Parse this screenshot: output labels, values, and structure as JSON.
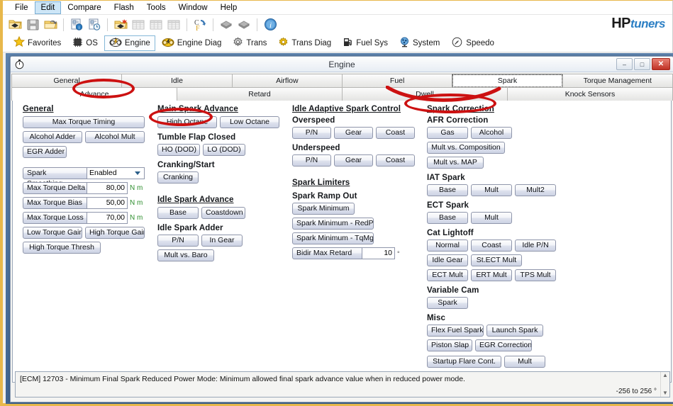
{
  "app": {
    "brand_main": "HP",
    "brand_sub": "tuners"
  },
  "menubar": {
    "items": [
      {
        "label": "File",
        "active": false
      },
      {
        "label": "Edit",
        "active": true
      },
      {
        "label": "Compare",
        "active": false
      },
      {
        "label": "Flash",
        "active": false
      },
      {
        "label": "Tools",
        "active": false
      },
      {
        "label": "Window",
        "active": false
      },
      {
        "label": "Help",
        "active": false
      }
    ]
  },
  "toolbar": {
    "icons": [
      "open-folder-icon",
      "save-disk-icon",
      "open-recent-icon",
      "separator",
      "compare-info-icon",
      "compare-history-icon",
      "separator",
      "open-flash-icon",
      "table-grid-1-icon",
      "table-grid-2-icon",
      "table-grid-3-icon",
      "separator",
      "units-convert-icon",
      "separator",
      "diamond-gray-icon",
      "diamond-gray-2-icon",
      "separator",
      "info-icon"
    ]
  },
  "ribbon": {
    "items": [
      {
        "label": "Favorites",
        "icon": "star-icon",
        "selected": false
      },
      {
        "label": "OS",
        "icon": "chip-icon",
        "selected": false
      },
      {
        "label": "Engine",
        "icon": "engine-icon",
        "selected": true
      },
      {
        "label": "Engine Diag",
        "icon": "engine-diag-icon",
        "selected": false
      },
      {
        "label": "Trans",
        "icon": "gear-icon",
        "selected": false
      },
      {
        "label": "Trans Diag",
        "icon": "gear-diag-icon",
        "selected": false
      },
      {
        "label": "Fuel Sys",
        "icon": "fuel-pump-icon",
        "selected": false
      },
      {
        "label": "System",
        "icon": "system-icon",
        "selected": false
      },
      {
        "label": "Speedo",
        "icon": "speedo-icon",
        "selected": false
      }
    ]
  },
  "window": {
    "title": "Engine",
    "icon": "stopwatch-icon",
    "minimize": "–",
    "maximize": "□",
    "close": "✕"
  },
  "tabs_row1": [
    {
      "label": "General",
      "state": "normal"
    },
    {
      "label": "Idle",
      "state": "normal"
    },
    {
      "label": "Airflow",
      "state": "normal"
    },
    {
      "label": "Fuel",
      "state": "normal"
    },
    {
      "label": "Spark",
      "state": "focus"
    },
    {
      "label": "Torque Management",
      "state": "normal"
    }
  ],
  "tabs_row2": [
    {
      "label": "Advance",
      "state": "selected"
    },
    {
      "label": "Retard",
      "state": "normal"
    },
    {
      "label": "Dwell",
      "state": "normal"
    },
    {
      "label": "Knock Sensors",
      "state": "normal"
    }
  ],
  "col1": {
    "heading": "General",
    "btn_max_torque_timing": "Max Torque Timing",
    "btn_alcohol_adder": "Alcohol Adder",
    "btn_alcohol_mult": "Alcohol Mult",
    "btn_egr_adder": "EGR Adder",
    "spark_smoothing_label": "Spark Smoothing",
    "spark_smoothing_value": "Enabled",
    "max_torque_delta_label": "Max Torque Delta",
    "max_torque_delta_value": "80,00",
    "max_torque_delta_unit": "N m",
    "max_torque_bias_label": "Max Torque Bias",
    "max_torque_bias_value": "50,00",
    "max_torque_bias_unit": "N m",
    "max_torque_loss_label": "Max Torque Loss",
    "max_torque_loss_value": "70,00",
    "max_torque_loss_unit": "N m",
    "btn_low_torque_gain": "Low Torque Gain",
    "btn_high_torque_gain": "High Torque Gain",
    "btn_high_torque_thresh": "High Torque Thresh"
  },
  "col2": {
    "heading": "Main Spark Advance",
    "btn_high_octane": "High Octane",
    "btn_low_octane": "Low Octane",
    "sub_tumble": "Tumble Flap Closed",
    "btn_ho_dod": "HO (DOD)",
    "btn_lo_dod": "LO (DOD)",
    "sub_cranking": "Cranking/Start",
    "btn_cranking": "Cranking",
    "heading2": "Idle Spark Advance",
    "btn_base": "Base",
    "btn_coastdown": "Coastdown",
    "sub_idle_adder": "Idle Spark Adder",
    "btn_pn": "P/N",
    "btn_in_gear": "In Gear",
    "btn_mult_vs_baro": "Mult vs. Baro"
  },
  "col3": {
    "heading": "Idle Adaptive Spark Control",
    "sub_overspeed": "Overspeed",
    "over_pn": "P/N",
    "over_gear": "Gear",
    "over_coast": "Coast",
    "sub_underspeed": "Underspeed",
    "under_pn": "P/N",
    "under_gear": "Gear",
    "under_coast": "Coast",
    "heading2": "Spark Limiters",
    "sub_ramp_out": "Spark Ramp Out",
    "btn_spark_minimum": "Spark Minimum",
    "btn_spark_min_redpwr": "Spark Minimum - RedPwr",
    "btn_spark_min_tqmgt": "Spark Minimum - TqMgt",
    "bidir_label": "Bidir Max Retard",
    "bidir_value": "10",
    "bidir_unit": "°"
  },
  "col4": {
    "heading": "Spark Correction",
    "sub_afr": "AFR Correction",
    "btn_gas": "Gas",
    "btn_alcohol": "Alcohol",
    "btn_mult_vs_composition": "Mult vs. Composition",
    "btn_mult_vs_map": "Mult vs. MAP",
    "sub_iat": "IAT Spark",
    "iat_base": "Base",
    "iat_mult": "Mult",
    "iat_mult2": "Mult2",
    "sub_ect": "ECT Spark",
    "ect_base": "Base",
    "ect_mult": "Mult",
    "sub_cat": "Cat Lightoff",
    "cat_normal": "Normal",
    "cat_coast": "Coast",
    "cat_idle_pn": "Idle P/N",
    "cat_idle_gear": "Idle Gear",
    "cat_st_ect_mult": "St.ECT Mult",
    "cat_ect_mult": "ECT Mult",
    "cat_ert_mult": "ERT Mult",
    "cat_tps_mult": "TPS Mult",
    "sub_vcam": "Variable Cam",
    "vcam_spark": "Spark",
    "sub_misc": "Misc",
    "misc_flex_fuel_spark": "Flex Fuel Spark",
    "misc_launch_spark": "Launch Spark",
    "misc_piston_slap": "Piston Slap",
    "misc_egr_correction": "EGR Correction",
    "misc_startup_flare": "Startup Flare Cont.",
    "misc_mult": "Mult"
  },
  "description": {
    "text": "[ECM] 12703 - Minimum Final Spark Reduced Power Mode: Minimum allowed final spark advance value when in reduced power mode.",
    "range": "-256 to 256 °",
    "scroll_up": "▲",
    "scroll_down": "▼"
  },
  "annotations": [
    {
      "name": "advance-tab-highlight"
    },
    {
      "name": "high-octane-highlight"
    },
    {
      "name": "spark-correction-highlight"
    },
    {
      "name": "dwell-tab-highlight"
    }
  ],
  "colors": {
    "annotation_red": "#cc1111",
    "brand_blue": "#2c7fc4",
    "window_border": "#e8b84b",
    "unit_green": "#2f8f2f"
  }
}
